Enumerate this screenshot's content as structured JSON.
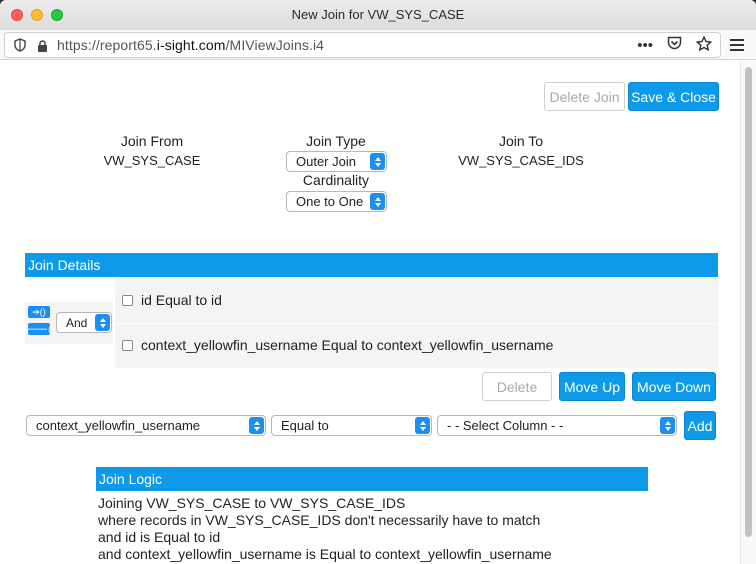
{
  "window": {
    "title": "New Join for VW_SYS_CASE"
  },
  "browser": {
    "url_prefix": "https://report65.",
    "url_domain": "i-sight.com",
    "url_path": "/MIViewJoins.i4",
    "icons": [
      "shield-icon",
      "lock-icon",
      "more-icon",
      "pocket-icon",
      "bookmark-star-icon",
      "hamburger-menu-icon"
    ]
  },
  "toolbar": {
    "delete_join": "Delete Join",
    "save_close": "Save & Close"
  },
  "join": {
    "from_label": "Join From",
    "from_value": "VW_SYS_CASE",
    "type_label": "Join Type",
    "type_value": "Outer Join",
    "cardinality_label": "Cardinality",
    "cardinality_value": "One to One",
    "to_label": "Join To",
    "to_value": "VW_SYS_CASE_IDS"
  },
  "details": {
    "header": "Join Details",
    "operator": "And",
    "conditions": [
      "id Equal to id",
      "context_yellowfin_username Equal to context_yellowfin_username"
    ],
    "delete": "Delete",
    "move_up": "Move Up",
    "move_down": "Move Down"
  },
  "builder": {
    "column_value": "context_yellowfin_username",
    "operator_value": "Equal to",
    "target_value": "- - Select Column - -",
    "add": "Add"
  },
  "logic": {
    "header": "Join Logic",
    "lines": [
      "Joining VW_SYS_CASE to VW_SYS_CASE_IDS",
      "where records in VW_SYS_CASE_IDS don't necessarily have to match",
      "and id is Equal to id",
      "and context_yellowfin_username is Equal to context_yellowfin_username"
    ]
  },
  "colors": {
    "accent": "#0e9ae8",
    "select_arrow": "#1d8ff0",
    "panel_bg": "#f4f4f4"
  }
}
